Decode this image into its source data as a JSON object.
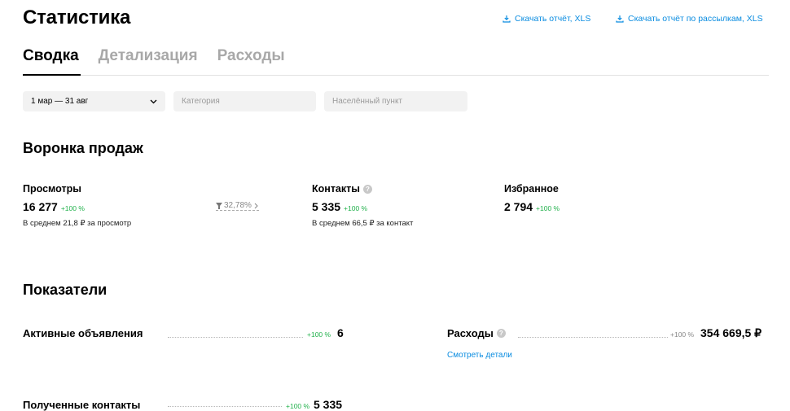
{
  "header": {
    "title": "Статистика",
    "download_report": "Скачать отчёт, XLS",
    "download_mailing_report": "Скачать отчёт по рассылкам, XLS"
  },
  "tabs": [
    {
      "label": "Сводка",
      "active": true
    },
    {
      "label": "Детализация",
      "active": false
    },
    {
      "label": "Расходы",
      "active": false
    }
  ],
  "filters": {
    "period": "1 мар — 31 авг",
    "category_placeholder": "Категория",
    "locality_placeholder": "Населённый пункт"
  },
  "funnel": {
    "title": "Воронка продаж",
    "views": {
      "label": "Просмотры",
      "value": "16 277",
      "change": "+100 %",
      "sub": "В среднем 21,8 ₽ за просмотр"
    },
    "conversion": "32,78%",
    "contacts": {
      "label": "Контакты",
      "value": "5 335",
      "change": "+100 %",
      "sub": "В среднем 66,5 ₽ за контакт"
    },
    "favorites": {
      "label": "Избранное",
      "value": "2 794",
      "change": "+100 %"
    }
  },
  "indicators": {
    "title": "Показатели",
    "active_ads": {
      "label": "Активные объявления",
      "change": "+100 %",
      "value": "6"
    },
    "expenses": {
      "label": "Расходы",
      "change": "+100 %",
      "value": "354 669,5 ₽",
      "details_link": "Смотреть детали"
    },
    "received_contacts": {
      "label": "Полученные контакты",
      "change": "+100 %",
      "value": "5 335"
    }
  },
  "colors": {
    "link": "#0a8ce0",
    "positive": "#22b14c",
    "filter_bg": "#f2f2f2"
  }
}
